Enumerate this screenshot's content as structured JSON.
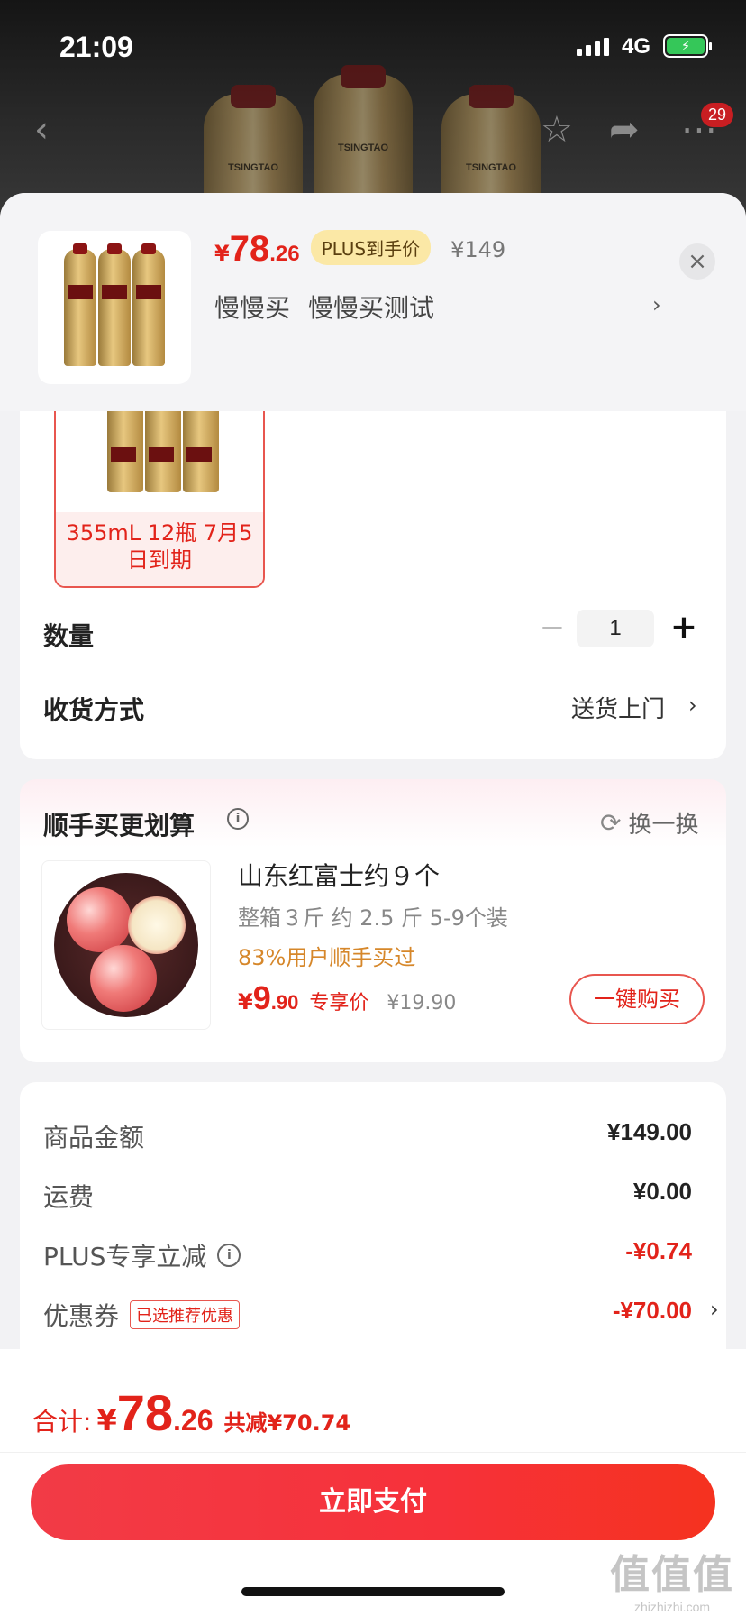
{
  "status_bar": {
    "time": "21:09",
    "network": "4G",
    "battery_icon": "battery-charging-icon"
  },
  "top_nav": {
    "back_icon": "back-icon",
    "favorite_icon": "star-icon",
    "share_icon": "share-icon",
    "more_icon": "more-icon",
    "message_badge": "29"
  },
  "background_bottle_label": "TSINGTAO",
  "product": {
    "price_yen": "¥",
    "price_int": "78",
    "price_dec": ".26",
    "plus_tag": "PLUS到手价",
    "original_price": "¥149",
    "spec_1": "慢慢买",
    "spec_2": "慢慢买测试",
    "spec_chevron": "›",
    "close": "×"
  },
  "sku": {
    "label": "355mL 12瓶 7月5日到期"
  },
  "quantity": {
    "label": "数量",
    "minus": "−",
    "value": "1",
    "plus": "+"
  },
  "shipping": {
    "label": "收货方式",
    "value": "送货上门",
    "chevron": "›"
  },
  "addon": {
    "title": "顺手买更划算",
    "info": "i",
    "swap_label": "换一换",
    "swap_icon": "refresh-icon",
    "item": {
      "name": "山东红富士约９个",
      "spec": "整箱３斤 约 2.5 斤 5-9个装",
      "buyers": "83%用户顺手买过",
      "price_yen": "¥",
      "price_int": "9",
      "price_dec": ".90",
      "price_tag": "专享价",
      "original_price": "¥19.90",
      "buy_button": "一键购买"
    }
  },
  "summary": {
    "rows": [
      {
        "label": "商品金额",
        "value": "¥149.00"
      },
      {
        "label": "运费",
        "value": "¥0.00"
      },
      {
        "label": "PLUS专享立减",
        "value": "-¥0.74"
      },
      {
        "label": "优惠券",
        "tag": "已选推荐优惠",
        "value": "-¥70.00",
        "chevron": "›"
      }
    ],
    "info": "i"
  },
  "footer": {
    "total_label": "合计:",
    "total_yen": "¥",
    "total_int": "78",
    "total_dec": ".26",
    "discount": "共减¥70.74",
    "pay_button": "立即支付"
  },
  "watermark": {
    "main": "值值值",
    "sub": "zhizhizhi.com"
  },
  "colors": {
    "accent": "#e2231a",
    "plus_tag_bg": "#fbe8a6",
    "buyers_text": "#d6872a"
  }
}
